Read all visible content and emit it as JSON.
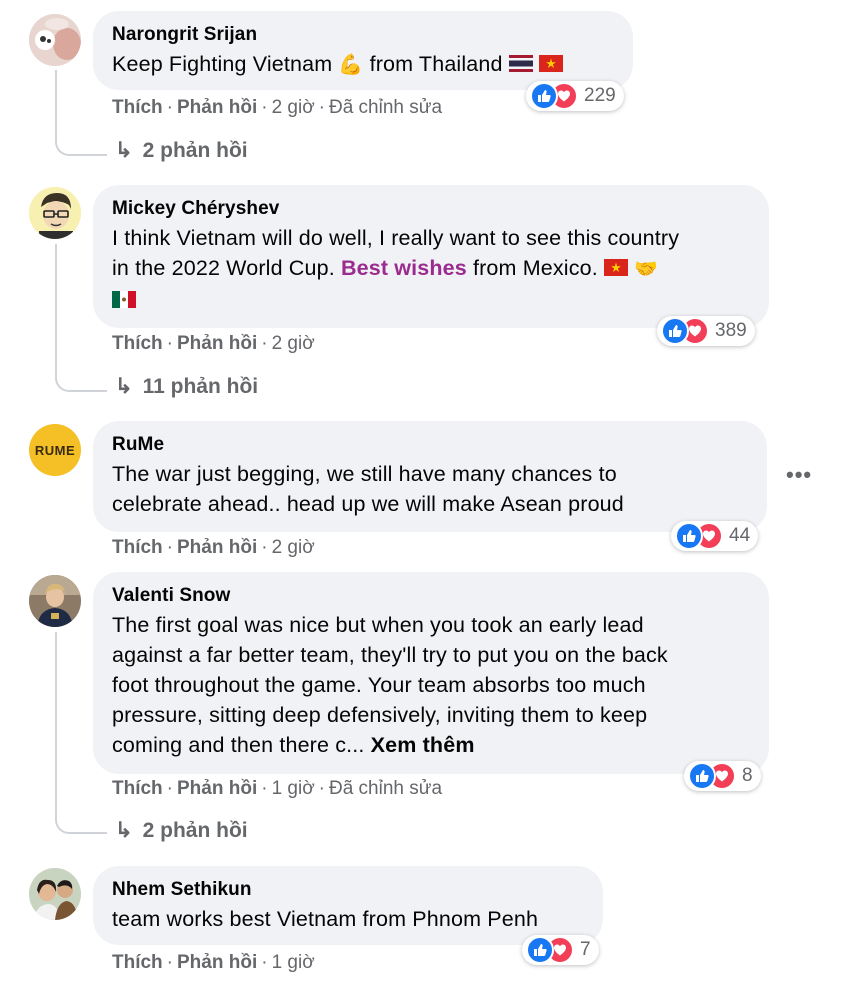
{
  "colors": {
    "like": "#1877f2",
    "love": "#f33e58",
    "meta": "#65676b",
    "bubble": "#f0f2f5",
    "highlight": "#9b2b8f"
  },
  "labels": {
    "like": "Thích",
    "reply": "Phản hồi",
    "sep": "·"
  },
  "comments": [
    {
      "name": "Narongrit Srijan",
      "text_before": "Keep Fighting Vietnam ",
      "emoji": "flexed-biceps",
      "text_after": " from Thailand ",
      "flags": [
        "thailand-flag",
        "vietnam-flag"
      ],
      "time": "2 giờ",
      "edited": "Đã chỉnh sửa",
      "reactions": "229",
      "replies": "2 phản hồi"
    },
    {
      "name": "Mickey Chéryshev",
      "line1": "I think Vietnam will do well, I really want to see this country",
      "line2_before": "in the 2022 World Cup. ",
      "line2_highlight": "Best wishes",
      "line2_after": " from Mexico. ",
      "flags": [
        "vietnam-flag",
        "handshake",
        "mexico-flag"
      ],
      "time": "2 giờ",
      "reactions": "389",
      "replies": "11 phản hồi"
    },
    {
      "name": "RuMe",
      "avatar_text": "RUME",
      "line1": "The war just begging, we still have many chances to",
      "line2": "celebrate ahead.. head up we will make Asean proud",
      "time": "2 giờ",
      "reactions": "44",
      "more": "•••"
    },
    {
      "name": "Valenti Snow",
      "line1": "The first goal was nice but when you took an early lead",
      "line2": "against a far better team, they'll try to put you on the back",
      "line3": "foot throughout the game. Your team absorbs too much",
      "line4": "pressure, sitting deep defensively, inviting them to keep",
      "line5": "coming and then there c... ",
      "see_more": "Xem thêm",
      "time": "1 giờ",
      "edited": "Đã chỉnh sửa",
      "reactions": "8",
      "replies": "2 phản hồi"
    },
    {
      "name": "Nhem Sethikun",
      "line1": "team works best Vietnam from Phnom Penh",
      "time": "1 giờ",
      "reactions": "7"
    }
  ]
}
